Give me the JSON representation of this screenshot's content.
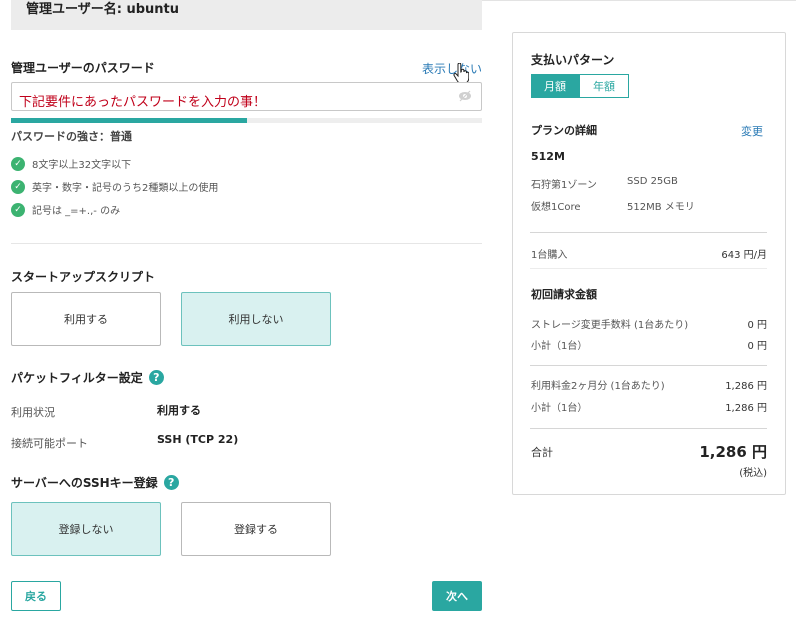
{
  "admin_user": {
    "label": "管理ユーザー名: ubuntu"
  },
  "password": {
    "label": "管理ユーザーのパスワード",
    "toggle_label": "表示しない",
    "input_value": "下記要件にあったパスワードを入力の事！",
    "strength_progress": 0.5,
    "strength_text": "パスワードの強さ：普通",
    "requirements": [
      "8文字以上32文字以下",
      "英字・数字・記号のうち2種類以上の使用",
      "記号は _=+.,- のみ"
    ]
  },
  "startup_script": {
    "title": "スタートアップスクリプト",
    "options": [
      "利用する",
      "利用しない"
    ],
    "selected": "利用しない"
  },
  "packet_filter": {
    "title": "パケットフィルター設定",
    "usage_label": "利用状況",
    "usage_value": "利用する",
    "port_label": "接続可能ポート",
    "port_value": "SSH (TCP 22)"
  },
  "ssh_key": {
    "title": "サーバーへのSSHキー登録",
    "options": [
      "登録しない",
      "登録する"
    ],
    "selected": "登録しない"
  },
  "buttons": {
    "back": "戻る",
    "next": "次へ"
  },
  "summary": {
    "payment_title": "支払いパターン",
    "tabs": [
      "月額",
      "年額"
    ],
    "active_tab": "月額",
    "plan_title": "プランの詳細",
    "change_link": "変更",
    "plan_name": "512M",
    "zone": "石狩第1ゾーン",
    "disk": "SSD 25GB",
    "cpu": "仮想1Core",
    "memory": "512MB メモリ",
    "purchase_label": "1台購入",
    "purchase_price": "643 円/月",
    "initial_title": "初回請求金額",
    "storage_fee_label": "ストレージ変更手数料 (1台あたり)",
    "storage_fee_value": "0 円",
    "subtotal1_label": "小計（1台）",
    "subtotal1_value": "0 円",
    "usage_fee_label": "利用料金2ヶ月分 (1台あたり)",
    "usage_fee_value": "1,286 円",
    "subtotal2_label": "小計（1台）",
    "subtotal2_value": "1,286 円",
    "total_label": "合計",
    "total_value": "1,286 円",
    "tax_note": "(税込)"
  },
  "colors": {
    "accent": "#2aa7a1",
    "link": "#2a7ab5",
    "error_text": "#c0001a",
    "check": "#3cb371"
  }
}
